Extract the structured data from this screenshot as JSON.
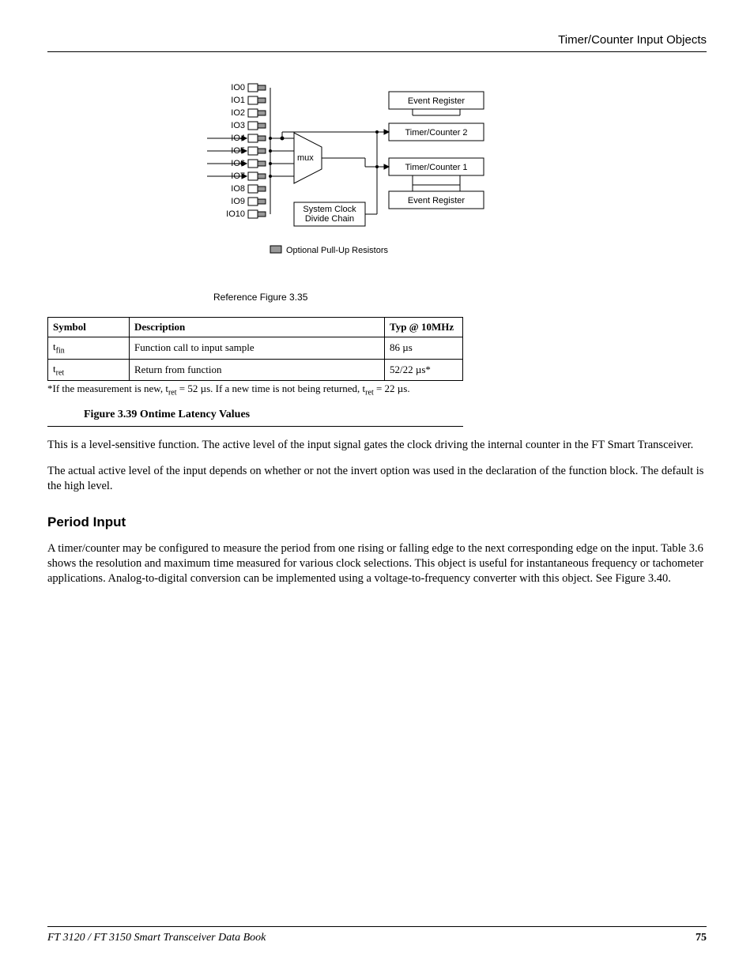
{
  "header": {
    "title": "Timer/Counter Input Objects"
  },
  "diagram": {
    "io_labels": [
      "IO0",
      "IO1",
      "IO2",
      "IO3",
      "IO4",
      "IO5",
      "IO6",
      "IO7",
      "IO8",
      "IO9",
      "IO10"
    ],
    "block_event1": "Event Register",
    "block_tc2": "Timer/Counter 2",
    "block_tc1": "Timer/Counter 1",
    "block_event2": "Event Register",
    "mux_label": "mux",
    "clock_label_line1": "System Clock",
    "clock_label_line2": "Divide Chain",
    "legend": "Optional Pull-Up Resistors",
    "caption": "Reference Figure 3.35"
  },
  "table": {
    "headers": {
      "symbol": "Symbol",
      "desc": "Description",
      "typ": "Typ @ 10MHz"
    },
    "rows": [
      {
        "sym_base": "t",
        "sym_sub": "fin",
        "desc": "Function call to input sample",
        "typ": "86 µs"
      },
      {
        "sym_base": "t",
        "sym_sub": "ret",
        "desc": "Return from function",
        "typ": "52/22 µs*"
      }
    ],
    "footnote_prefix": "*If the measurement is new, t",
    "footnote_sub1": "ret",
    "footnote_mid": " = 52 µs. If a new time is not being returned, t",
    "footnote_sub2": "ret",
    "footnote_suffix": " = 22 µs."
  },
  "figure_caption": "Figure 3.39  Ontime Latency Values",
  "body": {
    "p1": "This is a level-sensitive function. The active level of the input signal gates the clock driving the internal counter in the FT Smart Transceiver.",
    "p2": "The actual active level of the input depends on whether or not the invert option was used in the declaration of the function block. The default is the high level."
  },
  "section": {
    "heading": "Period Input",
    "p": "A timer/counter may be configured to measure the period from one rising or falling edge to the next corresponding edge on the input. Table 3.6 shows the resolution and maximum time measured for various clock selections. This object is useful for instantaneous frequency or tachometer applications. Analog-to-digital conversion can be implemented using a voltage-to-frequency converter with this object. See Figure 3.40."
  },
  "footer": {
    "book": "FT 3120 / FT 3150 Smart Transceiver Data Book",
    "page": "75"
  }
}
